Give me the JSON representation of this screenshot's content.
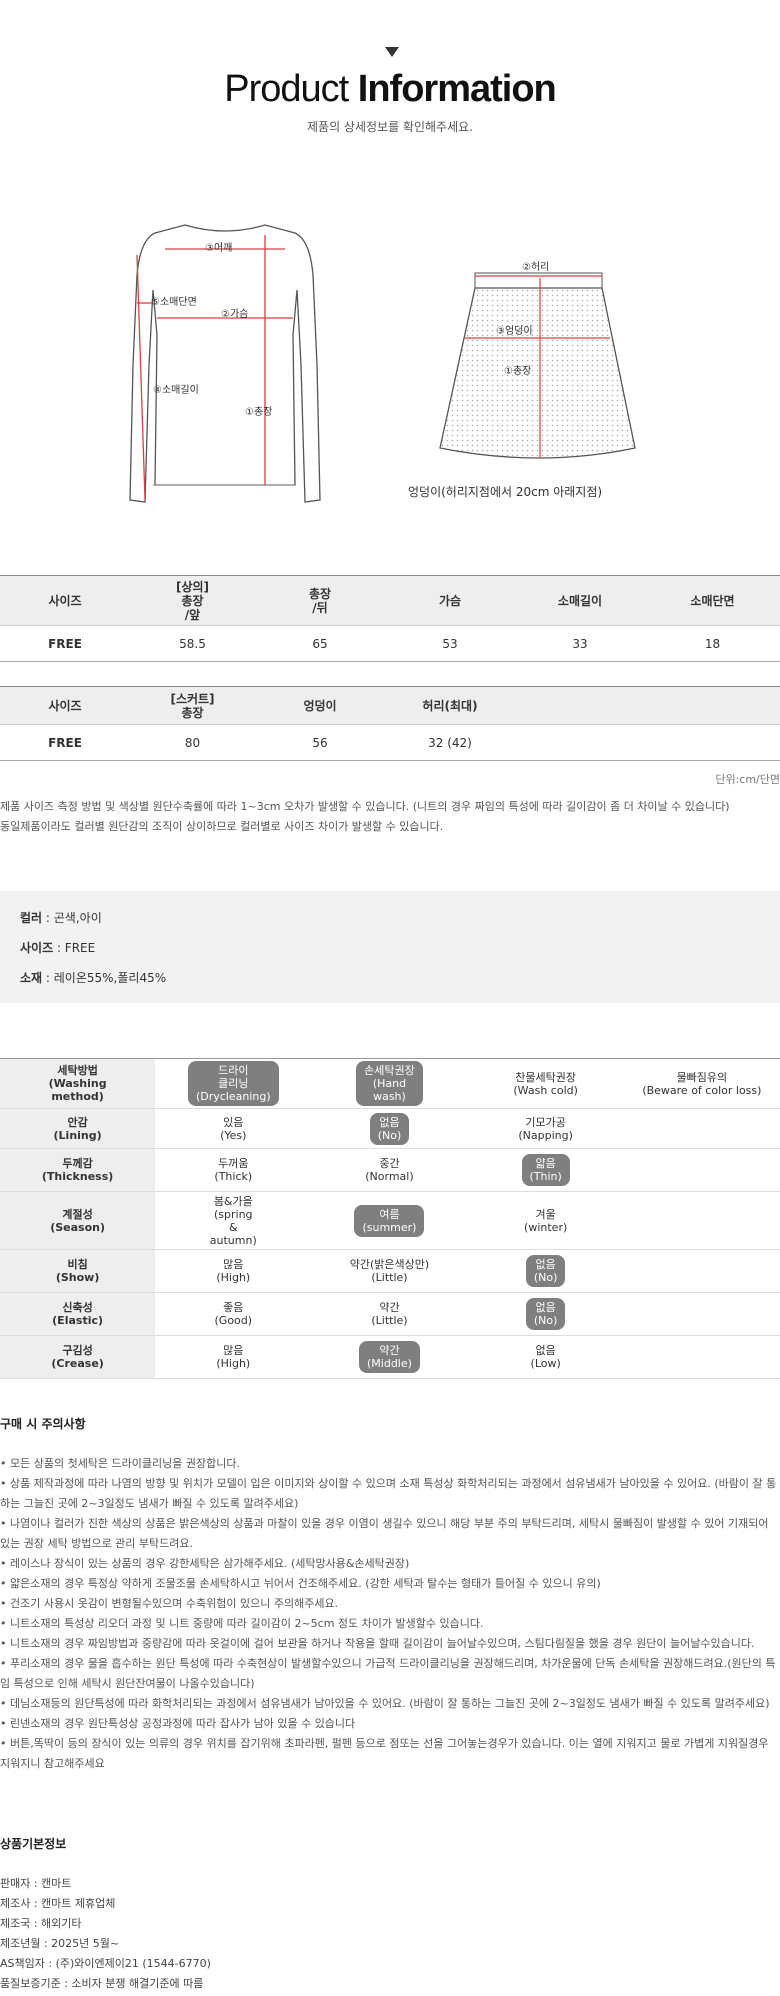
{
  "header": {
    "title_light": "Product",
    "title_bold": "Information",
    "subtitle": "제품의 상세정보를 확인해주세요."
  },
  "diagram": {
    "top_labels": [
      "③어깨",
      "⑤소매단면",
      "②가슴",
      "④소매길이",
      "①총장"
    ],
    "skirt_labels": [
      "②허리",
      "③엉덩이",
      "①총장"
    ],
    "skirt_caption": "엉덩이(허리지점에서 20cm 아래지점)"
  },
  "top_table": {
    "headers": [
      "사이즈",
      "[상의]\n총장\n/앞",
      "총장\n/뒤",
      "가슴",
      "소매길이",
      "소매단면"
    ],
    "row": [
      "FREE",
      "58.5",
      "65",
      "53",
      "33",
      "18"
    ]
  },
  "skirt_table": {
    "headers": [
      "사이즈",
      "[스커트]\n총장",
      "엉덩이",
      "허리(최대)",
      "",
      ""
    ],
    "row": [
      "FREE",
      "80",
      "56",
      "32 (42)",
      "",
      ""
    ]
  },
  "unit": "단위:cm/단면",
  "notes": [
    "제품 사이즈 측정 방법 및 색상별 원단수축률에 따라 1~3cm 오차가 발생할 수 있습니다. (니트의 경우 짜임의 특성에 따라 길이감이 좀 더 차이날 수 있습니다)",
    "동일제품이라도 컬러별 원단감의 조직이 상이하므로 컬러별로 사이즈 차이가 발생할 수 있습니다."
  ],
  "info": {
    "color_label": "컬러",
    "color_value": " : 곤색,아이",
    "size_label": "사이즈",
    "size_value": " : FREE",
    "material_label": "소재",
    "material_value": " : 레이온55%,폴리45%"
  },
  "wash_table": [
    {
      "label": "세탁방법\n(Washing\nmethod)",
      "cells": [
        "드라이\n클리닝\n(Drycleaning)",
        "손세탁권장\n(Hand\nwash)",
        "찬물세탁권장\n(Wash cold)",
        "물빠짐유의\n(Beware of color loss)"
      ],
      "active": [
        0,
        1
      ]
    },
    {
      "label": "안감\n(Lining)",
      "cells": [
        "있음\n(Yes)",
        "없음\n(No)",
        "기모가공\n(Napping)",
        ""
      ],
      "active": [
        1
      ]
    },
    {
      "label": "두께감\n(Thickness)",
      "cells": [
        "두꺼움\n(Thick)",
        "중간\n(Normal)",
        "얇음\n(Thin)",
        ""
      ],
      "active": [
        2
      ]
    },
    {
      "label": "계절성\n(Season)",
      "cells": [
        "봄&가을\n(spring\n&\nautumn)",
        "여름\n(summer)",
        "겨울\n(winter)",
        ""
      ],
      "active": [
        1
      ]
    },
    {
      "label": "비침\n(Show)",
      "cells": [
        "많음\n(High)",
        "약간(밝은색상만)\n(Little)",
        "없음\n(No)",
        ""
      ],
      "active": [
        2
      ]
    },
    {
      "label": "신축성\n(Elastic)",
      "cells": [
        "좋음\n(Good)",
        "약간\n(Little)",
        "없음\n(No)",
        ""
      ],
      "active": [
        2
      ]
    },
    {
      "label": "구김성\n(Crease)",
      "cells": [
        "많음\n(High)",
        "약간\n(Middle)",
        "없음\n(Low)",
        ""
      ],
      "active": [
        1
      ]
    }
  ],
  "caution_title": "구매 시 주의사항",
  "cautions": [
    "• 모든 상품의 첫세탁은 드라이클리닝을 권장합니다.",
    "• 상품 제작과정에 따라 나염의 방향 및 위치가 모델이 입은 이미지와 상이할 수 있으며 소재 특성상 화학처리되는 과정에서 섬유냄새가 남아있을 수 있어요. (바람이 잘 통",
    "하는 그늘진 곳에 2~3일정도 냄새가 빠질 수 있도록 말려주세요)",
    "• 나염이나 컬러가 진한 색상의 상품은 밝은색상의 상품과 마찰이 있을 경우 이염이 생길수 있으니 해당 부분 주의 부탁드리며, 세탁시 물빠짐이 발생할 수 있어 기재되어",
    "있는 권장 세탁 방법으로 관리 부탁드려요.",
    "• 레이스나 장식이 있는 상품의 경우 강한세탁은 삼가해주세요. (세탁망사용&손세탁권장)",
    "• 얇은소재의 경우 특정상 약하게 조물조물 손세탁하시고 뉘어서 건조해주세요. (강한 세탁과 탈수는 형태가 틀어질 수 있으니 유의)",
    "• 건조기 사용시 옷감이 변형될수있으며 수축위험이 있으니 주의해주세요.",
    "• 니트소재의 특성상 리오더 과정 및 니트 중량에 따라 길이감이 2~5cm 정도 차이가 발생할수 있습니다.",
    "• 니트소재의 경우 짜임방법과 중량감에 따라 옷걸이에 걸어 보관을 하거나 착용을 할때 길이감이 늘어날수있으며, 스팀다림질을 했을 경우 원단이 늘어날수있습니다.",
    "• 푸리소재의 경우 물을 흡수하는 원단 특성에 따라 수축현상이 발생할수있으니 가급적 드라이클리닝을 권장해드리며, 차가운물에 단독 손세탁을 권장해드려요.(원단의 특",
    "임 특성으로 인해 세탁시 원단잔여물이 나올수있습니다)",
    "• 데님소재등의 원단특성에 따라 화학처리되는 과정에서 섬유냄새가 남아있을 수 있어요. (바람이 잘 통하는 그늘진 곳에 2~3일정도 냄새가 빠질 수 있도록 말려주세요)",
    "• 린넨소재의 경우 원단특성상 공정과정에 따라 잡사가 남아 있을 수 있습니다",
    "• 버튼,똑딱이 등의 장식이 있는 의류의 경우 위치를 잡기위해 초파라펜, 펄펜 등으로 점또는 선을 그어놓는경우가 있습니다. 이는 열에 지워지고 물로 가볍게 지워질경우",
    "지워지니 참고해주세요"
  ],
  "base_title": "상품기본정보",
  "base_info": [
    "판매자 : 캔마트",
    "제조사 : 캔마트 제휴업체",
    "제조국 : 해외기타",
    "제조년월 : 2025년 5월~",
    "AS책임자 : (주)와이엔제이21 (1544-6770)",
    "품질보증기준 : 소비자 분쟁 해결기준에 따름"
  ],
  "colors": {
    "pill": "#7f7f7f",
    "header_bg": "#eeeeee",
    "info_bg": "#f2f2f2",
    "measure_red": "#d94040"
  }
}
